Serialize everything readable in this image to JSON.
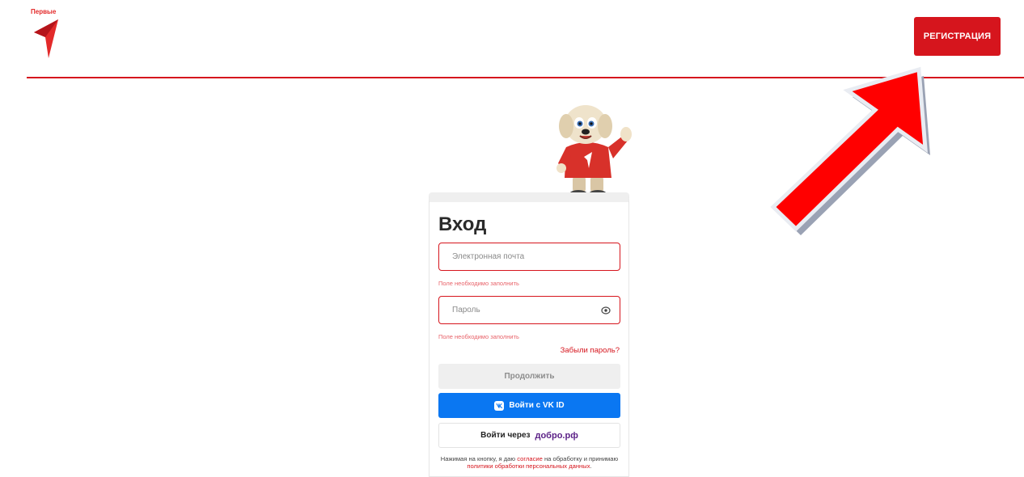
{
  "header": {
    "logo_text": "Первые",
    "register_label": "РЕГИСТРАЦИЯ"
  },
  "login": {
    "title": "Вход",
    "email_placeholder": "Электронная почта",
    "email_error": "Поле необходимо заполнить",
    "password_placeholder": "Пароль",
    "password_error": "Поле необходимо заполнить",
    "forgot_label": "Забыли пароль?",
    "continue_label": "Продолжить",
    "vk_label": "Войти с VK ID",
    "dobro_prefix": "Войти через",
    "dobro_logo": "добро.рф",
    "consent": {
      "part1": "Нажимая на кнопку, я даю ",
      "link1": "согласие",
      "part2": " на обработку и принимаю ",
      "link2": "политики обработки персональных данных",
      "part3": "."
    }
  },
  "colors": {
    "brand_red": "#d6151d",
    "vk_blue": "#0a77f2",
    "error_text": "#e8636a",
    "annotation_arrow": "#ff0000"
  },
  "icons": {
    "password_toggle": "eye-icon",
    "vk": "vk-logo-icon",
    "logo": "first-logo-icon"
  }
}
